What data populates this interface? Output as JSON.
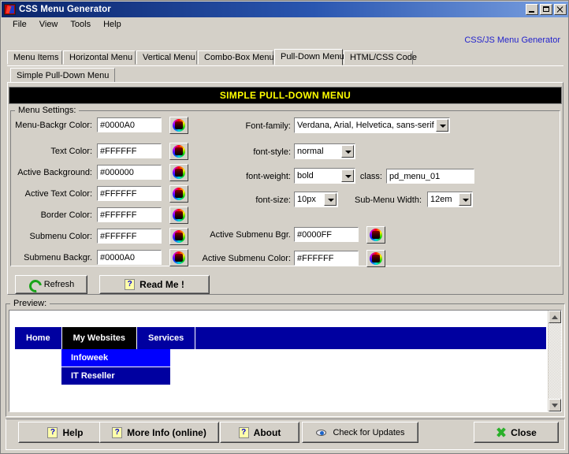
{
  "window": {
    "title": "CSS Menu Generator",
    "icon": "app-lightning-icon",
    "minimize": "_",
    "maximize": "□",
    "close": "×"
  },
  "menubar": {
    "items": [
      {
        "label": "File"
      },
      {
        "label": "View"
      },
      {
        "label": "Tools"
      },
      {
        "label": "Help"
      }
    ]
  },
  "corner_link": "CSS/JS Menu Generator",
  "tabs": {
    "selected": "Pull-Down Menu",
    "items": [
      {
        "label": "Menu Items"
      },
      {
        "label": "Horizontal Menu"
      },
      {
        "label": "Vertical Menu"
      },
      {
        "label": "Combo-Box Menu"
      },
      {
        "label": "Pull-Down Menu"
      },
      {
        "label": "HTML/CSS Code"
      }
    ]
  },
  "subtab": {
    "label": "Simple Pull-Down Menu"
  },
  "banner": "SIMPLE PULL-DOWN MENU",
  "group": {
    "title": "Menu Settings:"
  },
  "color_fields": [
    {
      "label": "Menu-Backgr Color:",
      "value": "#0000A0",
      "picker": "color-wheel-icon"
    },
    {
      "label": "Text Color:",
      "value": "#FFFFFF",
      "picker": "color-wheel-icon"
    },
    {
      "label": "Active Background:",
      "value": "#000000",
      "picker": "color-wheel-icon"
    },
    {
      "label": "Active Text Color:",
      "value": "#FFFFFF",
      "picker": "color-wheel-icon"
    },
    {
      "label": "Border Color:",
      "value": "#FFFFFF",
      "picker": "color-wheel-icon"
    },
    {
      "label": "Submenu Color:",
      "value": "#FFFFFF",
      "picker": "color-wheel-icon"
    },
    {
      "label": "Submenu Backgr.",
      "value": "#0000A0",
      "picker": "color-wheel-icon"
    }
  ],
  "font_fields": {
    "font_family": {
      "label": "Font-family:",
      "value": "Verdana, Arial, Helvetica, sans-serif"
    },
    "font_style": {
      "label": "font-style:",
      "value": "normal"
    },
    "font_weight": {
      "label": "font-weight:",
      "value": "bold"
    },
    "font_size": {
      "label": "font-size:",
      "value": "10px"
    },
    "class": {
      "label": "class:",
      "value": "pd_menu_01"
    },
    "submenu_width": {
      "label": "Sub-Menu Width:",
      "value": "12em"
    }
  },
  "right_color_fields": [
    {
      "label": "Active Submenu Bgr.",
      "value": "#0000FF",
      "picker": "color-wheel-icon"
    },
    {
      "label": "Active Submenu Color:",
      "value": "#FFFFFF",
      "picker": "color-wheel-icon"
    }
  ],
  "action_buttons": {
    "refresh": {
      "label": "Refresh",
      "icon": "refresh-icon"
    },
    "readme": {
      "label": "Read Me !",
      "icon": "question-icon"
    }
  },
  "preview": {
    "title": "Preview:",
    "menu_items": [
      {
        "label": "Home",
        "active": false
      },
      {
        "label": "My Websites",
        "active": true
      },
      {
        "label": "Services",
        "active": false
      }
    ],
    "submenu_items": [
      {
        "label": "Infoweek",
        "hot": true
      },
      {
        "label": "IT Reseller",
        "hot": false
      }
    ],
    "colors": {
      "menu_bg": "#0000A0",
      "active_bg": "#000000",
      "submenu_bg": "#0000A0",
      "active_submenu_bg": "#0000FF",
      "text": "#FFFFFF"
    }
  },
  "bottom_buttons": [
    {
      "label": "Help",
      "icon": "question-icon"
    },
    {
      "label": "More Info (online)",
      "icon": "question-icon"
    },
    {
      "label": "About",
      "icon": "question-icon"
    },
    {
      "label": "Check for Updates",
      "icon": "eye-icon"
    },
    {
      "label": "Close",
      "icon": "close-x-icon"
    }
  ]
}
